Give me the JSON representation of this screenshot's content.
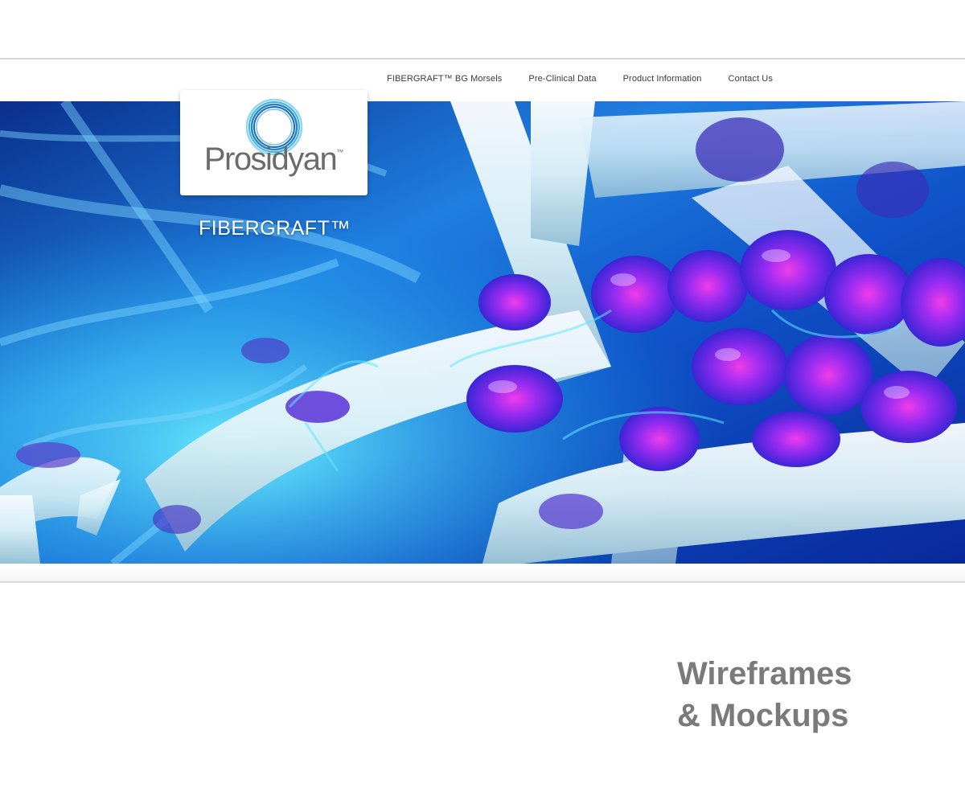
{
  "nav": {
    "items": [
      {
        "label": "FIBERGRAFT™ BG Morsels"
      },
      {
        "label": "Pre-Clinical Data"
      },
      {
        "label": "Product Information"
      },
      {
        "label": "Contact Us"
      }
    ]
  },
  "logo": {
    "brand": "Prosidyan",
    "trademark": "™",
    "icon": "concentric-circles-logo-icon"
  },
  "hero": {
    "product_name": "FIBERGRAFT™",
    "image": "bioactive-glass-fibers-with-cells-illustration"
  },
  "caption": {
    "line1": "Wireframes",
    "line2": "& Mockups"
  },
  "colors": {
    "caption_text": "#7a7a7a",
    "logo_blue": "#2a8fd6",
    "hero_deep_blue": "#0b3fae",
    "hero_cyan": "#3fd4f0",
    "cell_purple": "#6b2cf0",
    "cell_magenta": "#e030e8"
  }
}
